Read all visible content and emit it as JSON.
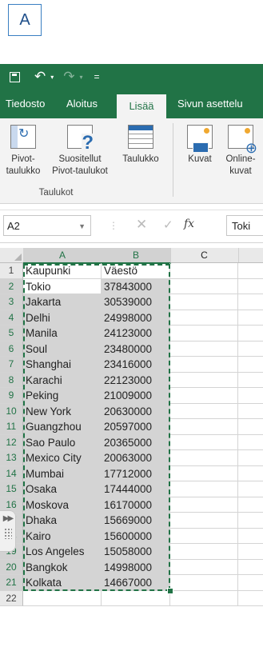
{
  "step_label": "A",
  "quick_access": {
    "save": "save",
    "undo_arrow": "↶",
    "redo_arrow": "↷",
    "customize": "="
  },
  "tabs": [
    {
      "label": "Tiedosto",
      "active": false
    },
    {
      "label": "Aloitus",
      "active": false
    },
    {
      "label": "Lisää",
      "active": true
    },
    {
      "label": "Sivun asettelu",
      "active": false
    }
  ],
  "ribbon": {
    "buttons": [
      {
        "label": "Pivot-\ntaulukko",
        "icon": "pivottable-icon"
      },
      {
        "label": "Suositellut\nPivot-taulukot",
        "icon": "recommended-pivottables-icon"
      },
      {
        "label": "Taulukko",
        "icon": "table-icon"
      },
      {
        "label": "Kuvat",
        "icon": "pictures-icon"
      },
      {
        "label": "Online-\nkuvat",
        "icon": "online-pictures-icon"
      }
    ],
    "group_label": "Taulukot"
  },
  "formula_bar": {
    "name_box": "A2",
    "fx": "fx",
    "content": "Toki"
  },
  "columns": [
    "A",
    "B",
    "C"
  ],
  "rows": [
    {
      "n": "1",
      "a": "Kaupunki",
      "b": "Väestö"
    },
    {
      "n": "2",
      "a": "Tokio",
      "b": "37843000"
    },
    {
      "n": "3",
      "a": "Jakarta",
      "b": "30539000"
    },
    {
      "n": "4",
      "a": "Delhi",
      "b": "24998000"
    },
    {
      "n": "5",
      "a": "Manila",
      "b": "24123000"
    },
    {
      "n": "6",
      "a": "Soul",
      "b": "23480000"
    },
    {
      "n": "7",
      "a": "Shanghai",
      "b": "23416000"
    },
    {
      "n": "8",
      "a": "Karachi",
      "b": "22123000"
    },
    {
      "n": "9",
      "a": "Peking",
      "b": "21009000"
    },
    {
      "n": "10",
      "a": "New York",
      "b": "20630000"
    },
    {
      "n": "11",
      "a": "Guangzhou",
      "b": "20597000"
    },
    {
      "n": "12",
      "a": "Sao Paulo",
      "b": "20365000"
    },
    {
      "n": "13",
      "a": "Mexico City",
      "b": "20063000"
    },
    {
      "n": "14",
      "a": "Mumbai",
      "b": "17712000"
    },
    {
      "n": "15",
      "a": "Osaka",
      "b": "17444000"
    },
    {
      "n": "16",
      "a": "Moskova",
      "b": "16170000"
    },
    {
      "n": "17",
      "a": "Dhaka",
      "b": "15669000"
    },
    {
      "n": "18",
      "a": "Kairo",
      "b": "15600000"
    },
    {
      "n": "19",
      "a": "Los Angeles",
      "b": "15058000"
    },
    {
      "n": "20",
      "a": "Bangkok",
      "b": "14998000"
    },
    {
      "n": "21",
      "a": "Kolkata",
      "b": "14667000"
    },
    {
      "n": "22",
      "a": "",
      "b": ""
    }
  ],
  "colors": {
    "excel_green": "#217346",
    "selection_fill": "#d4d4d4",
    "badge_border": "#3a7fc2"
  }
}
